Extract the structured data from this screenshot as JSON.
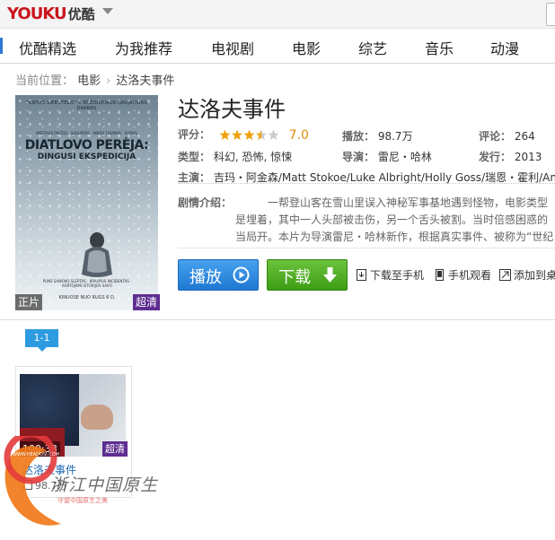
{
  "header": {
    "logo_en": "YOUKU",
    "logo_cn": "优酷"
  },
  "nav": {
    "items": [
      "优酷精选",
      "为我推荐",
      "电视剧",
      "电影",
      "综艺",
      "音乐",
      "动漫"
    ]
  },
  "breadcrumb": {
    "prefix": "当前位置：",
    "items": [
      "电影",
      "达洛夫事件"
    ]
  },
  "poster": {
    "top_text": "\"KIETAS SIEBUTELIS\" X REŽISIERIAUS NAUJAUSIAS DARBAS",
    "small_text": "MĖSTAUS PALTOS · SUKURTAS · ANDRI THOMAS · IVYRAS",
    "title": "DIATLOVO PERĖJA:",
    "subtitle": "DINGUSI EKSPEDICIJA",
    "tagline": "PUNS SAWOXO SLEPTAS · KRAUPUS INCIDENTAS · KARTOJAMI ISTORIJOS SAVO",
    "footer": "KINUOSE NUO RUGS 6 D.",
    "badge_left": "正片",
    "badge_right": "超清"
  },
  "info": {
    "title": "达洛夫事件",
    "rating_label": "评分：",
    "rating": "7.0",
    "rating_stars": 3.5,
    "plays_label": "播放：",
    "plays": "98.7万",
    "comments_label": "评论：",
    "comments": "264",
    "genre_label": "类型：",
    "genre": "科幻, 恐怖, 惊悚",
    "director_label": "导演：",
    "director": "雷尼・哈林",
    "release_label": "发行：",
    "release": "2013",
    "cast_label": "主演：",
    "cast": "吉玛・阿金森/Matt Stokoe/Luke Albright/Holly Goss/瑞恩・霍利/An",
    "desc_label": "剧情介绍：",
    "desc": "一帮登山客在雪山里误入神秘军事基地遇到怪物，电影类型是埋着，其中一人头部被击伤，另一个舌头被割。当时倍感困惑的当局开。本片为导演雷尼・哈林新作，根据真实事件、被称为“世纪之谜"
  },
  "actions": {
    "play": "播放",
    "download": "下载",
    "to_phone": "下载至手机",
    "phone_watch": "手机观看",
    "add_to": "添加到桌"
  },
  "episodes": {
    "tab": "1-1",
    "items": [
      {
        "duration": "100:38",
        "quality": "超清",
        "title": "达洛夫事件",
        "views": "98.7万"
      }
    ]
  },
  "watermark": {
    "text": "浙江中国原生",
    "sub": "守望中国原生之美",
    "ring": "WWW.HEADOSI.COM"
  },
  "colors": {
    "brand_red": "#c9161d",
    "play_blue": "#1f78d1",
    "download_green": "#3c9d13",
    "hd_purple": "#5e2d91",
    "score_orange": "#e08c0b"
  }
}
